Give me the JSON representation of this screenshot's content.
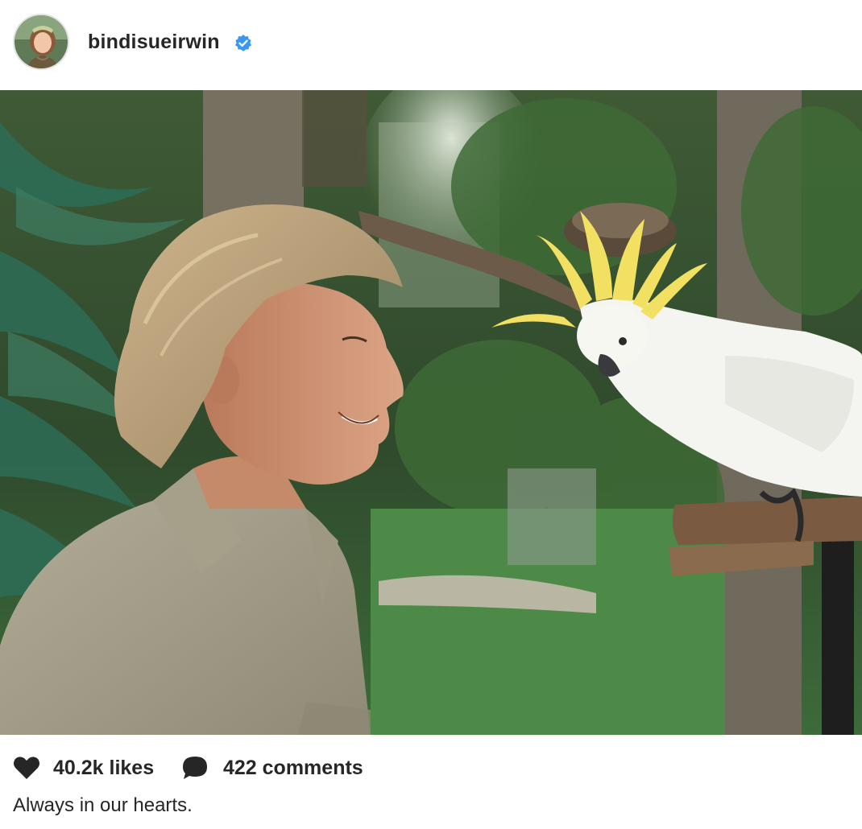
{
  "header": {
    "username": "bindisueirwin",
    "verified": true,
    "avatar_icon": "profile-avatar"
  },
  "photo": {
    "alt": "Man in khaki shirt smiling at a white cockatoo with yellow crest"
  },
  "engagement": {
    "likes_label": "40.2k likes",
    "comments_label": "422 comments",
    "heart_icon": "heart-icon",
    "comment_icon": "comment-bubble-icon"
  },
  "caption": {
    "text": "Always in our hearts."
  },
  "colors": {
    "verified_blue": "#3897f0",
    "text": "#262626",
    "background": "#ffffff"
  }
}
